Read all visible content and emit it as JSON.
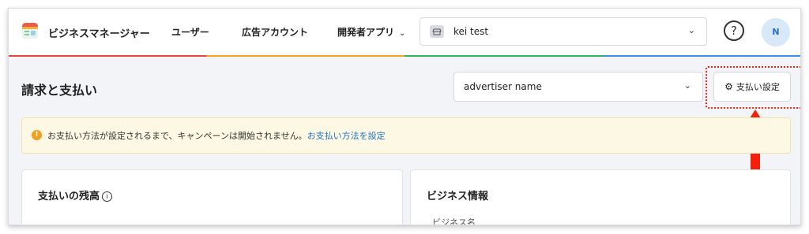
{
  "header": {
    "brand": "ビジネスマネージャー",
    "nav": [
      {
        "label": "ユーザー"
      },
      {
        "label": "広告アカウント"
      },
      {
        "label": "開発者アプリ"
      }
    ],
    "account_selector": "kei test",
    "help": "?",
    "avatar": "N"
  },
  "page": {
    "title": "請求と支払い",
    "advertiser_select": "advertiser name",
    "payment_settings_button": "支払い設定"
  },
  "notice": {
    "text": "お支払い方法が設定されるまで、キャンペーンは開始されません。",
    "link": "お支払い方法を設定"
  },
  "cards": {
    "balance_title": "支払いの残高",
    "business_title": "ビジネス情報",
    "business_name_label": "ビジネス名"
  },
  "colors": {
    "annotation": "#e02b1b",
    "link": "#1e73c9",
    "notice_bg": "#fcf8e3"
  }
}
